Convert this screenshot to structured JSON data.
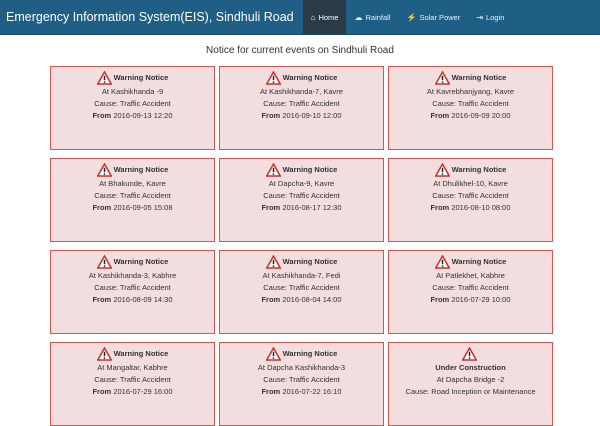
{
  "nav": {
    "brand": "Emergency Information System(EIS), Sindhuli Road",
    "items": [
      {
        "label": "Home",
        "icon": "home-icon",
        "glyph": "⌂",
        "active": true
      },
      {
        "label": "Rainfall",
        "icon": "cloud-icon",
        "glyph": "☁",
        "active": false
      },
      {
        "label": "Solar Power",
        "icon": "bolt-icon",
        "glyph": "⚡",
        "active": false
      },
      {
        "label": "Login",
        "icon": "login-icon",
        "glyph": "⇥",
        "active": false
      }
    ]
  },
  "page": {
    "title": "Notice for current events on Sindhuli Road"
  },
  "labels": {
    "from": "From"
  },
  "notices": [
    {
      "type": "Warning Notice",
      "location": "At Kashikhanda -9",
      "cause": "Cause: Traffic Accident",
      "date": "2016-09-13 12:20"
    },
    {
      "type": "Warning Notice",
      "location": "At Kashikhanda-7, Kavre",
      "cause": "Cause: Traffic Accident",
      "date": "2016-09-10 12:00"
    },
    {
      "type": "Warning Notice",
      "location": "At Kavrebhanjyang, Kavre",
      "cause": "Cause: Traffic Accident",
      "date": "2016-09-09 20:00"
    },
    {
      "type": "Warning Notice",
      "location": "At Bhakunde, Kavre",
      "cause": "Cause: Traffic Accident",
      "date": "2016-09-05 15:08"
    },
    {
      "type": "Warning Notice",
      "location": "At Dapcha-9, Kavre",
      "cause": "Cause: Traffic Accident",
      "date": "2016-08-17 12:30"
    },
    {
      "type": "Warning Notice",
      "location": "At Dhulikhel-10, Kavre",
      "cause": "Cause: Traffic Accident",
      "date": "2016-08-10 08:00"
    },
    {
      "type": "Warning Notice",
      "location": "At Kashikhanda-3, Kabhre",
      "cause": "Cause: Traffic Accident",
      "date": "2016-08-09 14:30"
    },
    {
      "type": "Warning Notice",
      "location": "At Kashikhanda-7, Fedi",
      "cause": "Cause: Traffic Accident",
      "date": "2016-08-04 14:00"
    },
    {
      "type": "Warning Notice",
      "location": "At Patlekhet, Kabhre",
      "cause": "Cause: Traffic Accident",
      "date": "2016-07-29 10:00"
    },
    {
      "type": "Warning Notice",
      "location": "At Mangaltar, Kabhre",
      "cause": "Cause: Traffic Accident",
      "date": "2016-07-29 16:00"
    },
    {
      "type": "Warning Notice",
      "location": "At Dapcha Kashikhanda-3",
      "cause": "Cause: Traffic Accident",
      "date": "2016-07-22 16:10"
    }
  ],
  "construction": {
    "type": "Under Construction",
    "location": "At Dapcha Bridge -2",
    "cause": "Cause: Road Inception or Maintenance"
  }
}
